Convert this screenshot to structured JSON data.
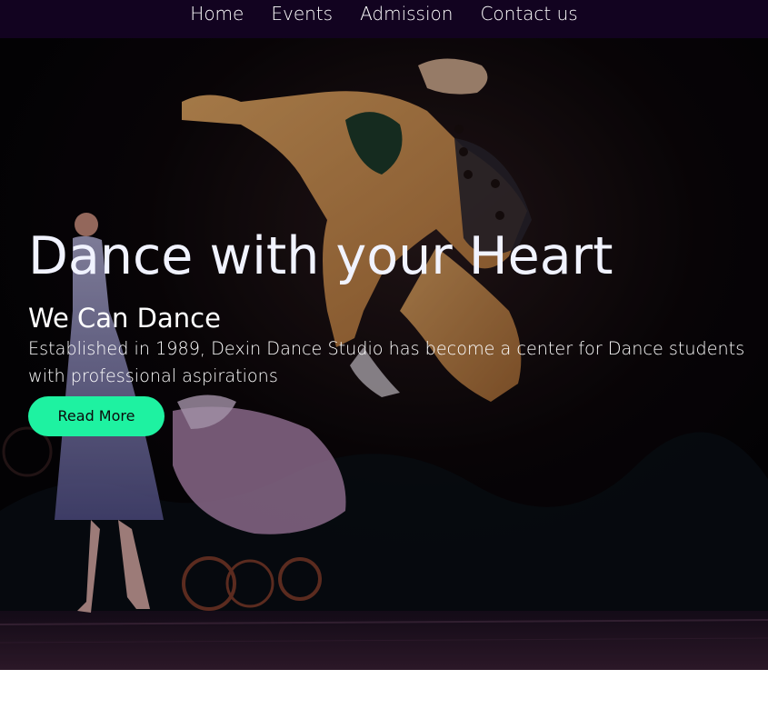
{
  "nav": {
    "items": [
      {
        "label": "Home"
      },
      {
        "label": "Events"
      },
      {
        "label": "Admission"
      },
      {
        "label": "Contact us"
      }
    ]
  },
  "hero": {
    "title": "Dance with your Heart",
    "subtitle": "We Can Dance",
    "description": "Established in 1989, Dexin Dance Studio has become a center for Dance students with professional aspirations",
    "button_label": "Read More"
  },
  "colors": {
    "nav_background": "#120320",
    "button_background": "#1ef2a1",
    "title_text": "#f1f3ff"
  }
}
